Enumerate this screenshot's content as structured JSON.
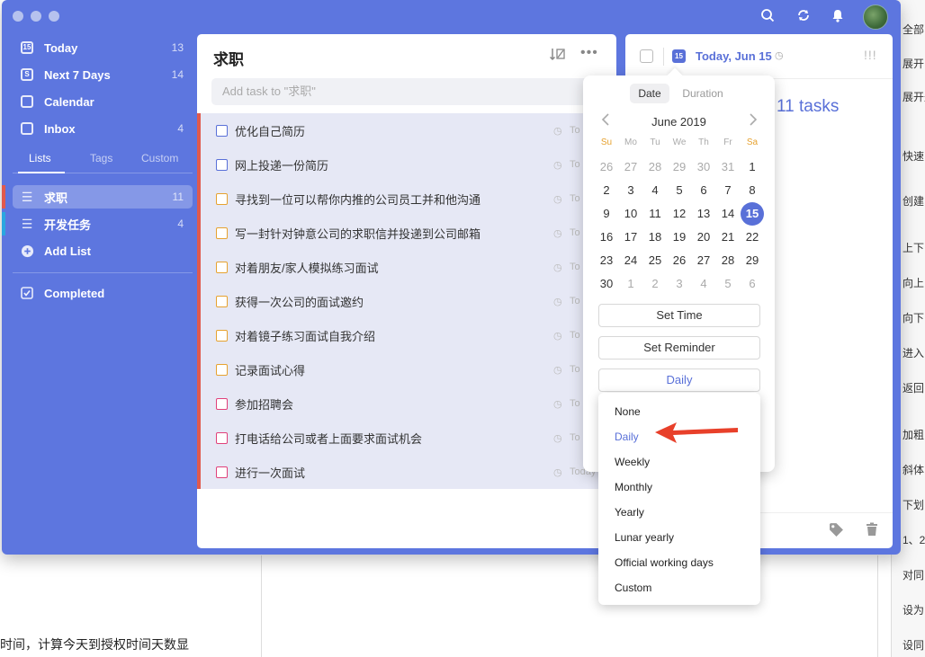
{
  "sidebar": {
    "smart": [
      {
        "label": "Today",
        "count": "13",
        "icon": "calendar-today-icon",
        "badge": "15"
      },
      {
        "label": "Next 7 Days",
        "count": "14",
        "icon": "calendar-week-icon",
        "badge": "S"
      },
      {
        "label": "Calendar",
        "count": "",
        "icon": "calendar-icon",
        "badge": ""
      },
      {
        "label": "Inbox",
        "count": "4",
        "icon": "inbox-icon",
        "badge": ""
      }
    ],
    "tabs": [
      "Lists",
      "Tags",
      "Custom"
    ],
    "lists": [
      {
        "label": "求职",
        "count": "11",
        "color": "#e05a4d"
      },
      {
        "label": "开发任务",
        "count": "4",
        "color": "#2aa7e0"
      }
    ],
    "add_list": "Add List",
    "completed": "Completed"
  },
  "task_panel": {
    "title": "求职",
    "add_placeholder": "Add task to \"求职\"",
    "tasks": [
      {
        "text": "优化自己简历",
        "due": "To",
        "color": "#5970d8"
      },
      {
        "text": "网上投递一份简历",
        "due": "To",
        "color": "#5970d8"
      },
      {
        "text": "寻找到一位可以帮你内推的公司员工并和他沟通",
        "due": "To",
        "color": "#e6a230"
      },
      {
        "text": "写一封针对钟意公司的求职信并投递到公司邮箱",
        "due": "To",
        "color": "#e6a230"
      },
      {
        "text": "对着朋友/家人模拟练习面试",
        "due": "To",
        "color": "#e6a230"
      },
      {
        "text": "获得一次公司的面试邀约",
        "due": "To",
        "color": "#e6a230"
      },
      {
        "text": "对着镜子练习面试自我介绍",
        "due": "To",
        "color": "#e6a230"
      },
      {
        "text": "记录面试心得",
        "due": "To",
        "color": "#e6a230"
      },
      {
        "text": "参加招聘会",
        "due": "To",
        "color": "#e0407a"
      },
      {
        "text": "打电话给公司或者上面要求面试机会",
        "due": "To",
        "color": "#e0407a"
      },
      {
        "text": "进行一次面试",
        "due": "Today",
        "color": "#e0407a"
      }
    ]
  },
  "detail": {
    "date_label": "Today, Jun 15",
    "cal_badge": "15",
    "tasks_text": "11 tasks"
  },
  "date_popover": {
    "tabs": [
      "Date",
      "Duration"
    ],
    "month": "June 2019",
    "weekdays": [
      "Su",
      "Mo",
      "Tu",
      "We",
      "Th",
      "Fr",
      "Sa"
    ],
    "weeks": [
      [
        "26",
        "27",
        "28",
        "29",
        "30",
        "31",
        "1"
      ],
      [
        "2",
        "3",
        "4",
        "5",
        "6",
        "7",
        "8"
      ],
      [
        "9",
        "10",
        "11",
        "12",
        "13",
        "14",
        "15"
      ],
      [
        "16",
        "17",
        "18",
        "19",
        "20",
        "21",
        "22"
      ],
      [
        "23",
        "24",
        "25",
        "26",
        "27",
        "28",
        "29"
      ],
      [
        "30",
        "1",
        "2",
        "3",
        "4",
        "5",
        "6"
      ]
    ],
    "selected_day": "15",
    "set_time": "Set Time",
    "set_reminder": "Set Reminder",
    "repeat_value": "Daily"
  },
  "repeat_menu": {
    "items": [
      "None",
      "Daily",
      "Weekly",
      "Monthly",
      "Yearly",
      "Lunar yearly",
      "Official working days",
      "Custom"
    ],
    "selected": "Daily",
    "arrow_color": "#e8402a"
  },
  "background": {
    "right_items": [
      "全部",
      "展开",
      "展开题",
      "快速",
      "创建",
      "上下",
      "向上",
      "向下",
      "进入",
      "返回",
      "加粗",
      "斜体",
      "下划",
      "1、2",
      "对同",
      "设为",
      "设同"
    ],
    "caption": "时间，计算今天到授权时间天数显"
  },
  "colors": {
    "window_bg": "#5d76df",
    "accent": "#5970d8"
  }
}
